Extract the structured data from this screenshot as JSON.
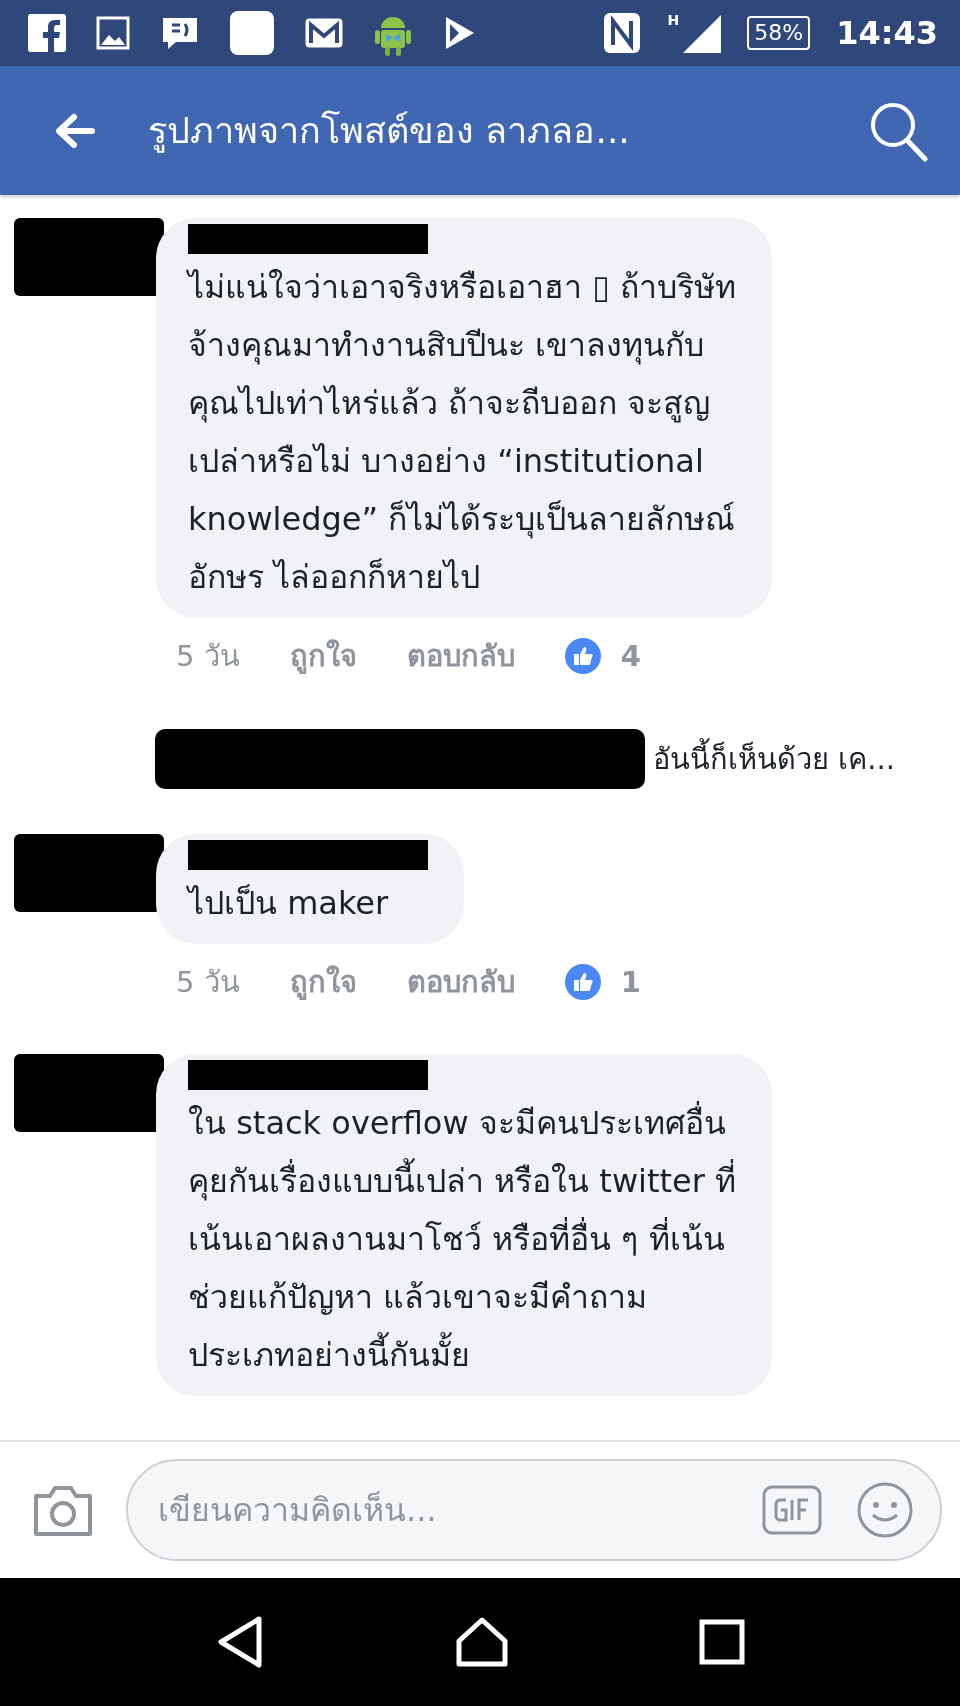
{
  "status_bar": {
    "network": "H",
    "battery": "58%",
    "time": "14:43"
  },
  "header": {
    "title": "รูปภาพจากโพสต์ของ ลาภลอ..."
  },
  "comments": [
    {
      "kind": "comment",
      "text": "ไม่แน่ใจว่าเอาจริงหรือเอาฮา ▯ ถ้าบริษัท\nจ้างคุณมาทำงานสิบปีนะ เขาลงทุนกับ\nคุณไปเท่าไหร่แล้ว ถ้าจะถีบออก จะสูญ\nเปล่าหรือไม่ บางอย่าง “institutional\nknowledge” ก็ไม่ได้ระบุเป็นลายลักษณ์\nอักษร ไล่ออกก็หายไป",
      "time": "5 วัน",
      "like": "ถูกใจ",
      "reply": "ตอบกลับ",
      "reactions": "4"
    },
    {
      "kind": "reply_preview",
      "text": "อันนี้ก็เห็นด้วย เค..."
    },
    {
      "kind": "comment",
      "text": "ไปเป็น maker",
      "time": "5 วัน",
      "like": "ถูกใจ",
      "reply": "ตอบกลับ",
      "reactions": "1"
    },
    {
      "kind": "comment",
      "text": "ใน stack overflow จะมีคนประเทศอื่น\nคุยกันเรื่องแบบนี้เปล่า หรือใน twitter ที่\nเน้นเอาผลงานมาโชว์ หรือที่อื่น ๆ ที่เน้น\nช่วยแก้ปัญหา แล้วเขาจะมีคำถาม\nประเภทอย่างนี้กันมั้ย"
    }
  ],
  "composer": {
    "placeholder": "เขียนความคิดเห็น..."
  }
}
